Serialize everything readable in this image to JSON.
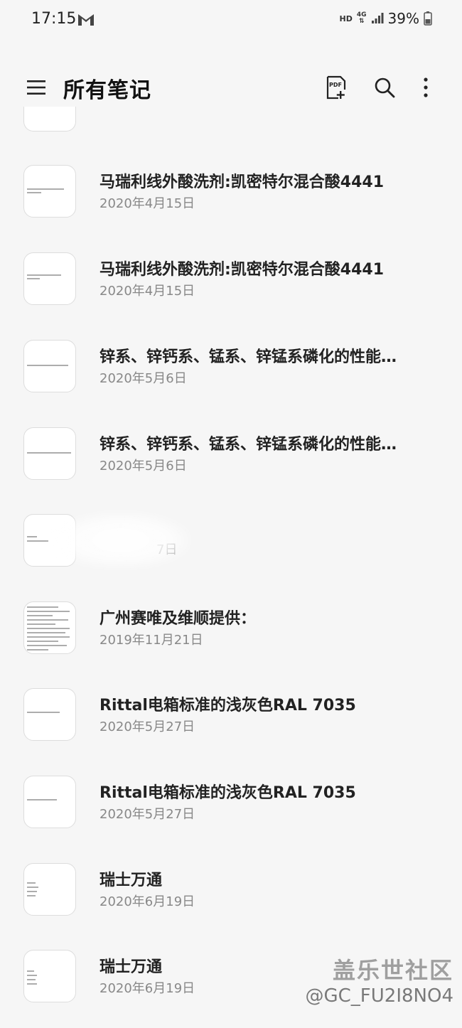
{
  "status_bar": {
    "time": "17:15",
    "hd": "HD",
    "network": "4G",
    "battery": "39%"
  },
  "header": {
    "title": "所有笔记",
    "pdf_icon": "pdf-add-icon",
    "pdf_label": "PDF",
    "search_icon": "search-icon",
    "more_icon": "more-vertical-icon"
  },
  "notes": [
    {
      "title": "马瑞利线外酸洗剂:凯密特尔混合酸4441",
      "date": "2020年4月15日"
    },
    {
      "title": "马瑞利线外酸洗剂:凯密特尔混合酸4441",
      "date": "2020年4月15日"
    },
    {
      "title": "锌系、锌钙系、锰系、锌锰系磷化的性能…",
      "date": "2020年5月6日"
    },
    {
      "title": "锌系、锌钙系、锰系、锌锰系磷化的性能…",
      "date": "2020年5月6日"
    },
    {
      "title": "",
      "date": "7日"
    },
    {
      "title": "广州赛唯及维顺提供：",
      "date": "2019年11月21日"
    },
    {
      "title": "Rittal电箱标准的浅灰色RAL 7035",
      "date": "2020年5月27日"
    },
    {
      "title": "Rittal电箱标准的浅灰色RAL 7035",
      "date": "2020年5月27日"
    },
    {
      "title": "瑞士万通",
      "date": "2020年6月19日"
    },
    {
      "title": "瑞士万通",
      "date": "2020年6月19日"
    }
  ],
  "watermark": {
    "brand": "盖乐世社区",
    "user": "@GC_FU2I8NO4"
  }
}
